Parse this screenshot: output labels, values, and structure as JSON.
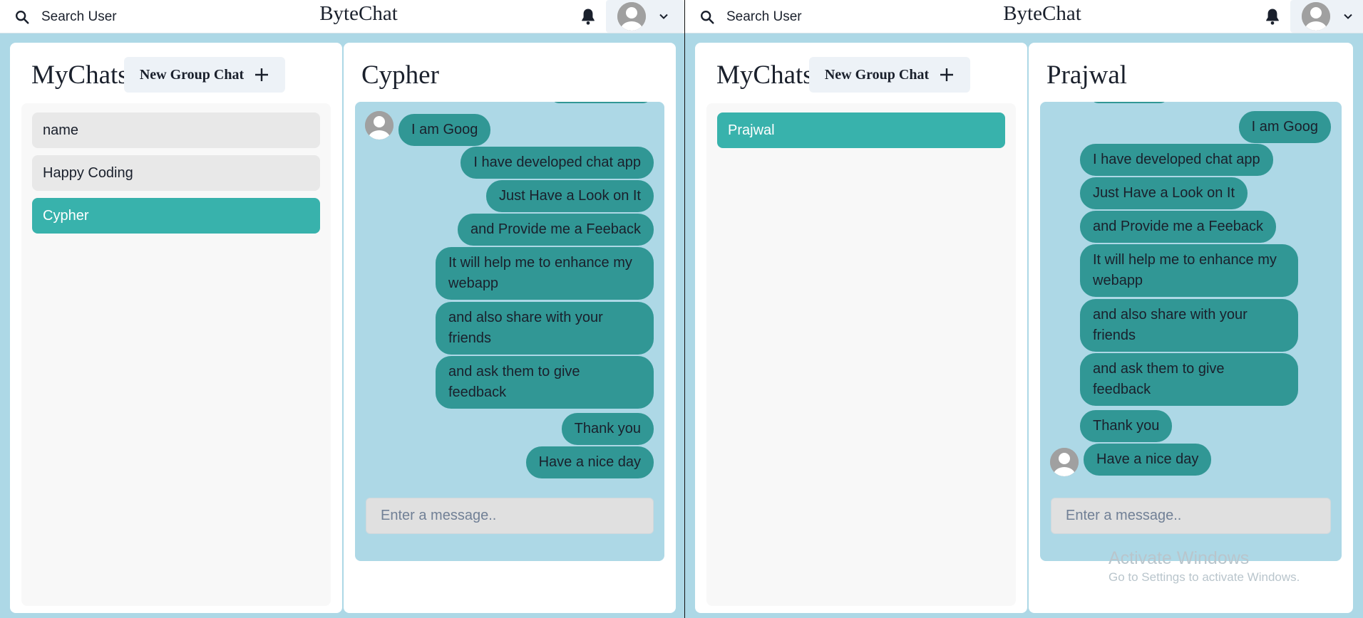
{
  "colors": {
    "accent": "#38b2ac",
    "bubble": "#319795",
    "background": "#add8e6"
  },
  "left": {
    "header": {
      "search_label": "Search User",
      "app_title": "ByteChat"
    },
    "mychats": {
      "title": "MyChats",
      "new_group_label": "New Group Chat",
      "items": [
        {
          "label": "name",
          "active": false
        },
        {
          "label": "Happy Coding",
          "active": false
        },
        {
          "label": "Cypher",
          "active": true
        }
      ]
    },
    "chat": {
      "name": "Cypher",
      "messages": [
        {
          "text": "I am Goog",
          "side": "left",
          "avatar": true
        },
        {
          "text": "I have developed chat app",
          "side": "right"
        },
        {
          "text": "Just Have a Look on It",
          "side": "right"
        },
        {
          "text": "and Provide me a Feeback",
          "side": "right"
        },
        {
          "text": "It will help me to enhance my webapp",
          "side": "right"
        },
        {
          "text": "and also share with your friends",
          "side": "right"
        },
        {
          "text": "and ask them to give feedback",
          "side": "right"
        },
        {
          "text": "Thank you",
          "side": "right"
        },
        {
          "text": "Have a nice day",
          "side": "right"
        }
      ],
      "input_placeholder": "Enter a message.."
    }
  },
  "right": {
    "header": {
      "search_label": "Search User",
      "app_title": "ByteChat"
    },
    "mychats": {
      "title": "MyChats",
      "new_group_label": "New Group Chat",
      "items": [
        {
          "label": "Prajwal",
          "active": true
        }
      ]
    },
    "chat": {
      "name": "Prajwal",
      "messages": [
        {
          "text": "I am Goog",
          "side": "right"
        },
        {
          "text": "I have developed chat app",
          "side": "left"
        },
        {
          "text": "Just Have a Look on It",
          "side": "left"
        },
        {
          "text": "and Provide me a Feeback",
          "side": "left"
        },
        {
          "text": "It will help me to enhance my webapp",
          "side": "left"
        },
        {
          "text": "and also share with your friends",
          "side": "left"
        },
        {
          "text": "and ask them to give feedback",
          "side": "left"
        },
        {
          "text": "Thank you",
          "side": "left"
        },
        {
          "text": "Have a nice day",
          "side": "left",
          "avatar": true
        }
      ],
      "input_placeholder": "Enter a message.."
    }
  },
  "watermark": {
    "line1": "Activate Windows",
    "line2": "Go to Settings to activate Windows."
  }
}
